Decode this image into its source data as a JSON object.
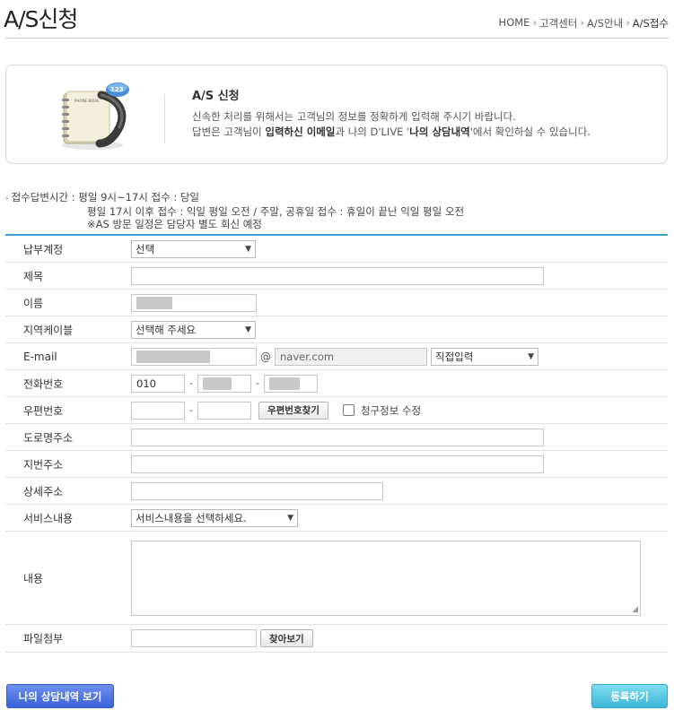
{
  "page": {
    "title": "A/S신청"
  },
  "breadcrumb": [
    "HOME",
    "고객센터",
    "A/S안내",
    "A/S접수"
  ],
  "intro": {
    "icon_text": "123",
    "icon_book_text": "PHONE BOOK",
    "title": "A/S 신청",
    "desc1": "신속한 처리를 위해서는 고객님의 정보를 정확하게 입력해 주시기 바랍니다.",
    "desc2_pre": "답변은 고객님이 ",
    "desc2_bold1": "입력하신 이메일",
    "desc2_mid": "과 나의 D'LIVE '",
    "desc2_bold2": "나의 상담내역",
    "desc2_post": "'에서 확인하실 수 있습니다."
  },
  "notice": {
    "line1": "접수답변시간 : 평일 9시~17시 접수 : 당일",
    "line2": "평일 17시 이후 접수 : 익일 평일 오전 / 주말, 공휴일 접수 : 휴일이 끝난 익일 평일 오전",
    "line3": "※AS 방문 일정은 담당자 별도 회신 예정"
  },
  "form": {
    "account": {
      "label": "납부계정",
      "value": "선택"
    },
    "subject": {
      "label": "제목"
    },
    "name": {
      "label": "이름"
    },
    "region": {
      "label": "지역케이블",
      "value": "선택해 주세요"
    },
    "email": {
      "label": "E-mail",
      "at": "@",
      "domain": "naver.com",
      "domain_select": "직접입력"
    },
    "phone": {
      "label": "전화번호",
      "prefix": "010",
      "dash": "-"
    },
    "zipcode": {
      "label": "우편번호",
      "dash": "-",
      "search_button": "우편번호찾기",
      "checkbox_label": "청구정보 수정"
    },
    "road_address": {
      "label": "도로명주소"
    },
    "lot_address": {
      "label": "지번주소"
    },
    "detail_address": {
      "label": "상세주소"
    },
    "service": {
      "label": "서비스내용",
      "value": "서비스내용을 선택하세요."
    },
    "content": {
      "label": "내용"
    },
    "attachment": {
      "label": "파일첨부",
      "browse_button": "찾아보기"
    }
  },
  "buttons": {
    "history": "나의 상담내역 보기",
    "submit": "등록하기"
  },
  "colors": {
    "accent_line": "#3ba0d0",
    "history_button": "#3a63d8",
    "submit_button": "#3cb7d8"
  }
}
